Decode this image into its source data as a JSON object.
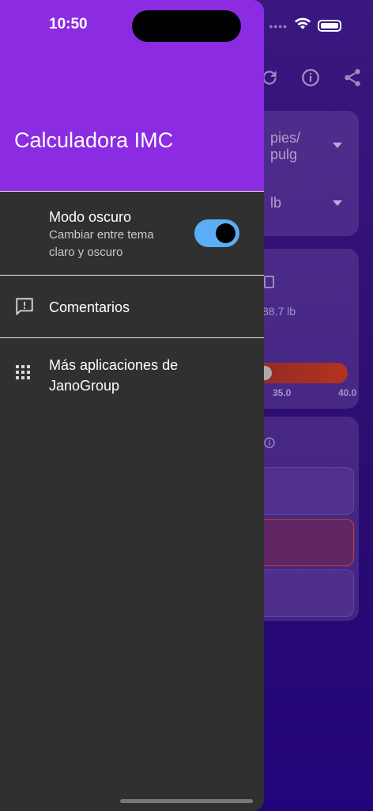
{
  "status": {
    "time": "10:50"
  },
  "drawer": {
    "title": "Calculadora IMC",
    "items": [
      {
        "title": "Modo oscuro",
        "subtitle": "Cambiar entre tema claro y oscuro",
        "toggle_on": true
      },
      {
        "title": "Comentarios",
        "icon": "feedback-icon"
      },
      {
        "title": "Más aplicaciones de JanoGroup",
        "icon": "apps-grid-icon"
      }
    ]
  },
  "background": {
    "height_unit": "pies/\npulg",
    "weight_unit": "lb",
    "weight_value": "88.7 lb",
    "scale_labels": [
      "35.0",
      "40.0"
    ]
  },
  "colors": {
    "header": "#8b2be2",
    "drawer": "#303030",
    "toggle": "#5aaef5"
  }
}
